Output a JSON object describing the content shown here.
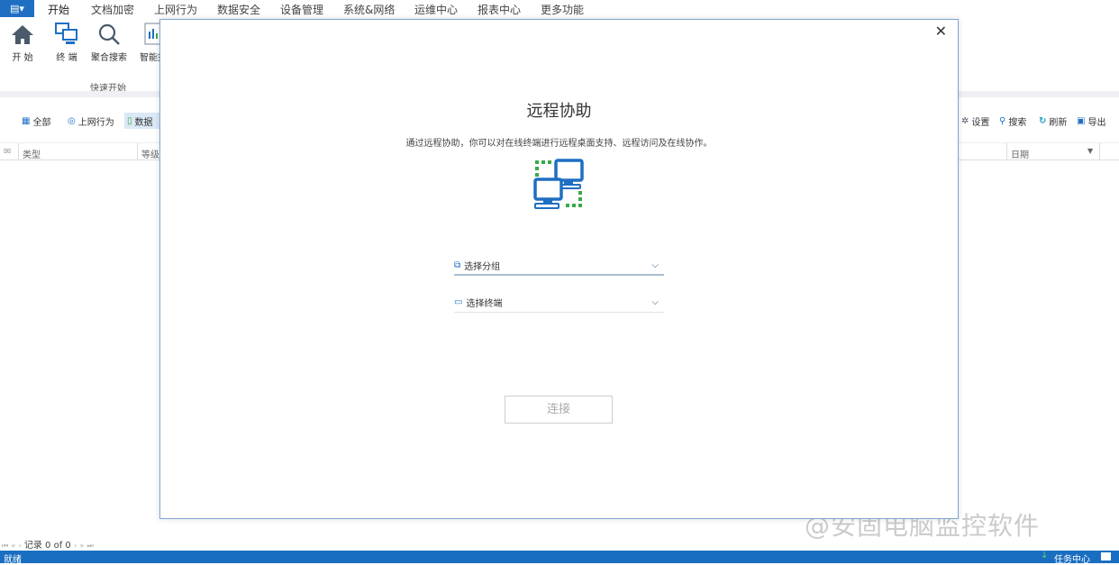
{
  "menu": {
    "app_button": "▤▾",
    "tabs": [
      "开始",
      "文档加密",
      "上网行为",
      "数据安全",
      "设备管理",
      "系统&网络",
      "运维中心",
      "报表中心",
      "更多功能"
    ],
    "active_tab": "开始"
  },
  "ribbon": {
    "buttons": [
      {
        "label": "开 始",
        "icon": "home-icon"
      },
      {
        "label": "终 端",
        "icon": "terminal-icon"
      },
      {
        "label": "聚合搜索",
        "icon": "search-icon"
      },
      {
        "label": "智能报",
        "icon": "report-icon"
      }
    ],
    "group_label": "快速开始"
  },
  "toolbar": {
    "left": [
      "全部",
      "上网行为",
      "数据"
    ],
    "right": [
      "设置",
      "搜索",
      "刷新",
      "导出"
    ]
  },
  "table": {
    "columns": [
      "类型",
      "等级",
      "日期"
    ]
  },
  "pager": {
    "first": "⏮",
    "prev_page": "«",
    "prev": "‹",
    "text": "记录 0 of 0",
    "next": "›",
    "next_page": "»",
    "last": "⏭"
  },
  "status": {
    "left": "就绪",
    "right": "任务中心"
  },
  "watermark": "@安固电脑监控软件",
  "dialog": {
    "title": "远程协助",
    "description": "通过远程协助，你可以对在线终端进行远程桌面支持、远程访问及在线协作。",
    "group_select": "选择分组",
    "terminal_select": "选择终端",
    "connect": "连接",
    "close": "✕"
  },
  "colors": {
    "accent": "#1e6fc2",
    "green": "#3aaa4a"
  }
}
